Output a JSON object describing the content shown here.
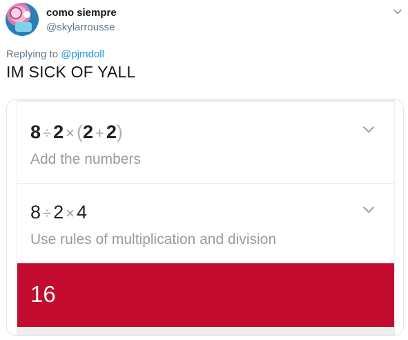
{
  "user": {
    "display_name": "como siempre",
    "handle": "@skylarrousse"
  },
  "reply": {
    "prefix": "Replying to ",
    "mention": "@pjmdoll"
  },
  "tweet": {
    "text": "IM SICK OF YALL"
  },
  "steps": [
    {
      "expression": {
        "a": "8",
        "op1": "÷",
        "b": "2",
        "op2": "×",
        "open_paren": "(",
        "c": "2",
        "op3": "+",
        "d": "2",
        "close_paren": ")"
      },
      "description": "Add the numbers"
    },
    {
      "expression": {
        "a": "8",
        "op1": "÷",
        "b": "2",
        "op2": "×",
        "c": "4"
      },
      "description": "Use rules of multiplication and division"
    }
  ],
  "result": {
    "value": "16"
  },
  "colors": {
    "result_bg": "#c20b2f",
    "mention": "#1b95e0",
    "muted": "#657786"
  },
  "icons": {
    "tweet_menu": "chevron-down-icon",
    "step_expand": "chevron-down-icon"
  }
}
